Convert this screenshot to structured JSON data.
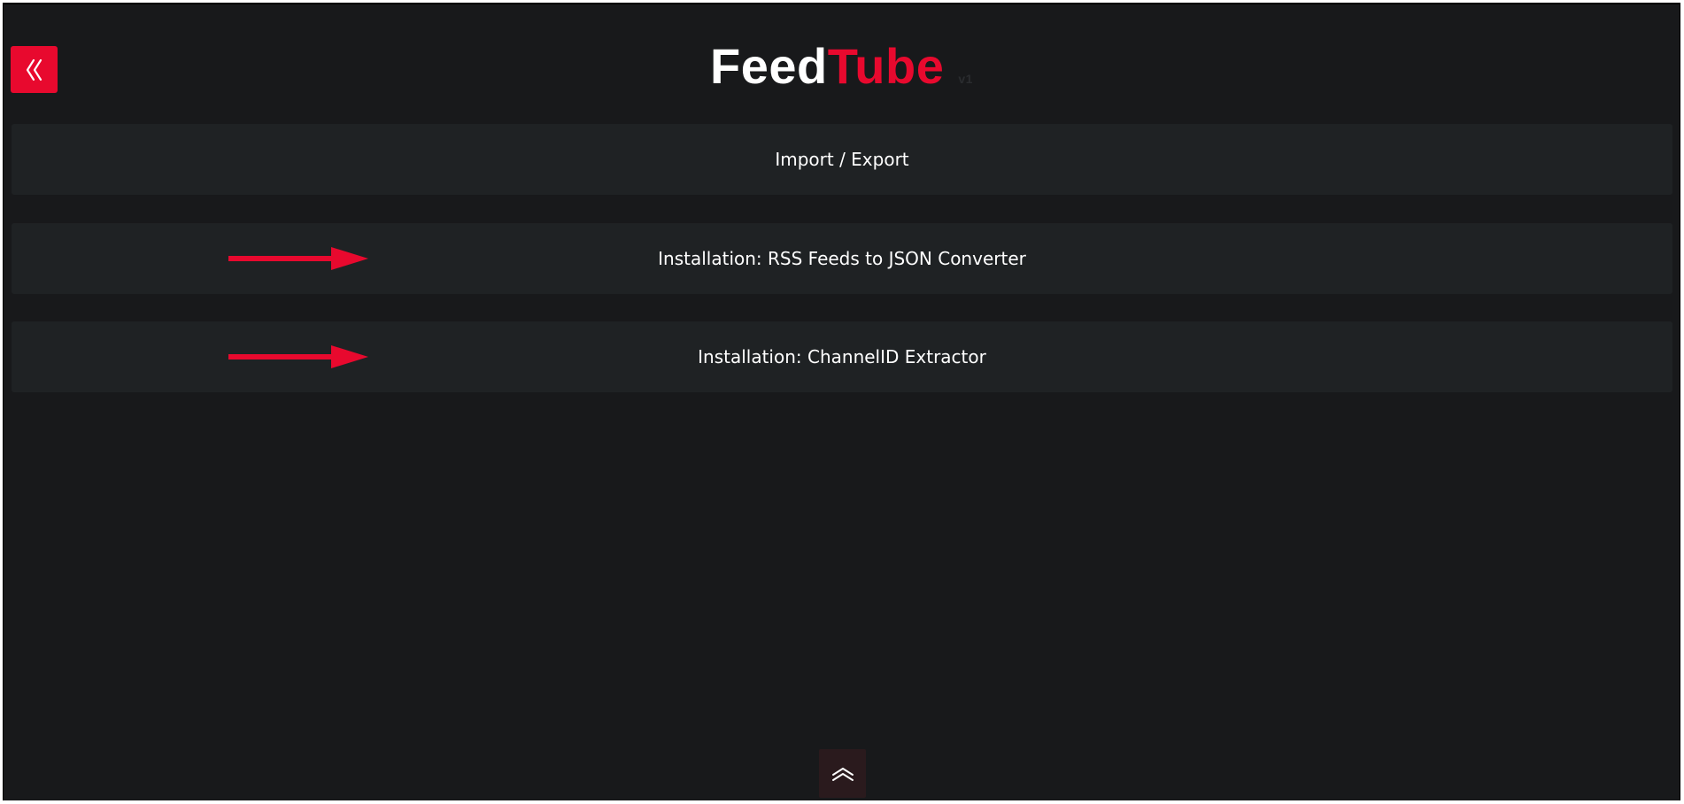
{
  "header": {
    "logo_feed": "Feed",
    "logo_tube": "Tube",
    "logo_suffix": "v1"
  },
  "panels": [
    {
      "label": "Import / Export"
    },
    {
      "label": "Installation: RSS Feeds to JSON Converter"
    },
    {
      "label": "Installation: ChannelID Extractor"
    }
  ],
  "colors": {
    "background": "#18191b",
    "panel": "#1f2224",
    "accent": "#e8092e",
    "text": "#ffffff"
  },
  "icons": {
    "back": "double-chevron-left-icon",
    "arrow": "arrow-right-icon",
    "scroll_top": "double-chevron-up-icon"
  }
}
